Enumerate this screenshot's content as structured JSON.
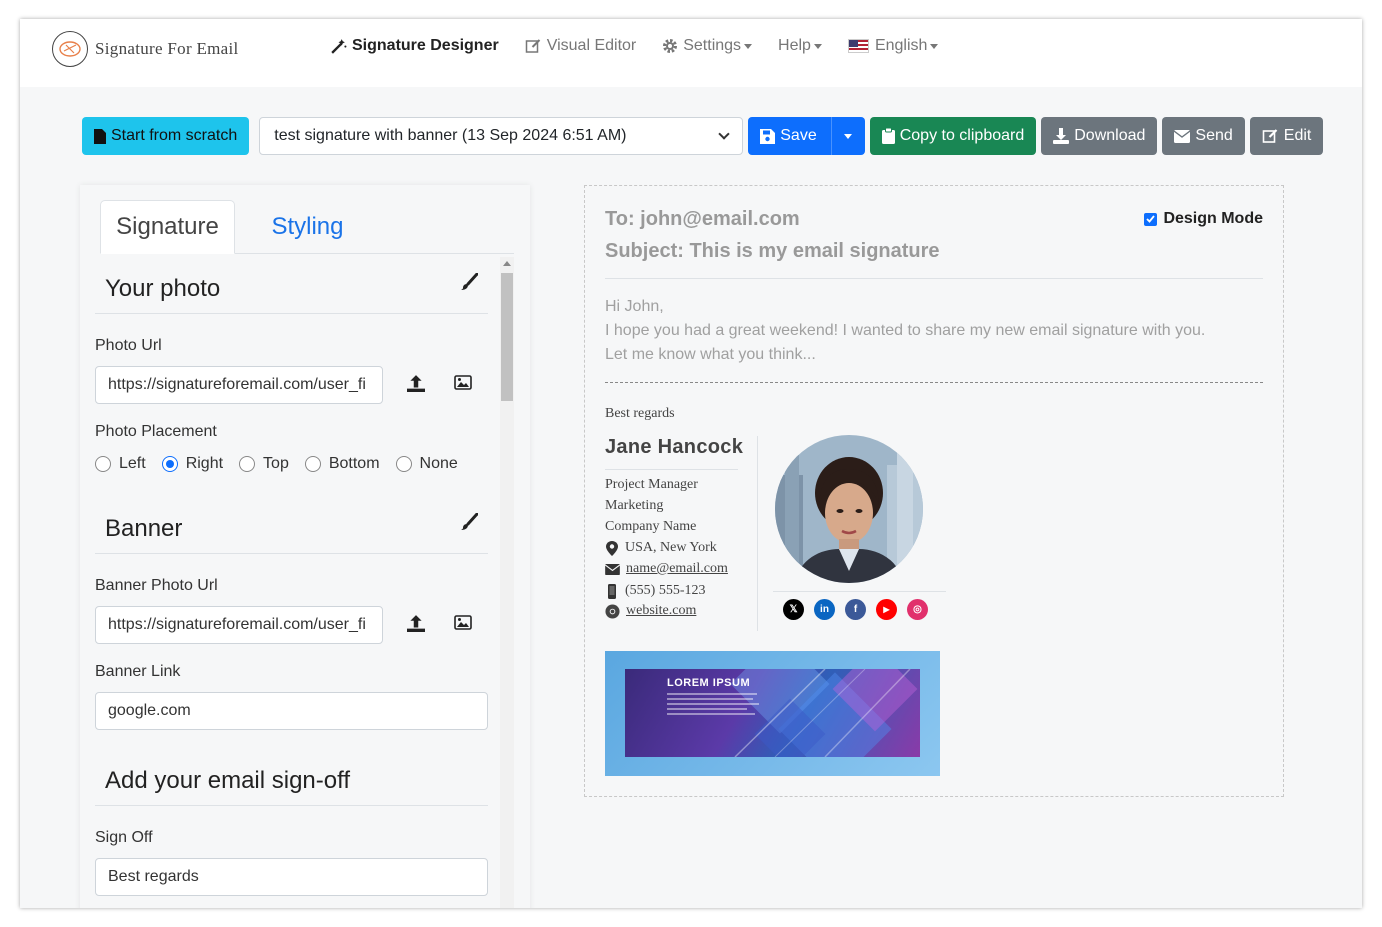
{
  "brand": {
    "name": "Signature For Email"
  },
  "nav": {
    "signature_designer": "Signature Designer",
    "visual_editor": "Visual Editor",
    "settings": "Settings",
    "help": "Help",
    "language": "English"
  },
  "toolbar": {
    "start_from_scratch": "Start from scratch",
    "selected_signature": "test signature with banner (13 Sep 2024 6:51 AM)",
    "save": "Save",
    "copy": "Copy to clipboard",
    "download": "Download",
    "send": "Send",
    "edit": "Edit"
  },
  "tabs": {
    "signature": "Signature",
    "styling": "Styling"
  },
  "photo_section": {
    "title": "Your photo",
    "photo_url_label": "Photo Url",
    "photo_url_value": "https://signatureforemail.com/user_fi",
    "placement_label": "Photo Placement",
    "placements": [
      "Left",
      "Right",
      "Top",
      "Bottom",
      "None"
    ],
    "selected_placement": "Right"
  },
  "banner_section": {
    "title": "Banner",
    "banner_url_label": "Banner Photo Url",
    "banner_url_value": "https://signatureforemail.com/user_fi",
    "banner_link_label": "Banner Link",
    "banner_link_value": "google.com"
  },
  "signoff_section": {
    "title": "Add your email sign-off",
    "label": "Sign Off",
    "value": "Best regards"
  },
  "preview": {
    "to": "To: john@email.com",
    "subject": "Subject: This is my email signature",
    "design_mode": "Design Mode",
    "design_mode_checked": true,
    "body_lines": [
      "Hi John,",
      "I hope you had a great weekend! I wanted to share my new email signature with you.",
      "Let me know what you think..."
    ]
  },
  "signature": {
    "sign_off": "Best regards",
    "name": "Jane Hancock",
    "title": "Project Manager",
    "department": "Marketing",
    "company": "Company Name",
    "location": "USA, New York",
    "email": "name@email.com",
    "phone": "(555) 555-123",
    "website": "website.com",
    "socials": [
      {
        "icon": "x-icon",
        "label": "𝕏",
        "color": "#000000"
      },
      {
        "icon": "linkedin-icon",
        "label": "in",
        "color": "#0a66c2"
      },
      {
        "icon": "facebook-icon",
        "label": "f",
        "color": "#3b5998"
      },
      {
        "icon": "youtube-icon",
        "label": "▶",
        "color": "#ff0000"
      },
      {
        "icon": "instagram-icon",
        "label": "◎",
        "color": "#e1306c"
      }
    ],
    "banner_title": "LOREM IPSUM"
  },
  "colors": {
    "primary": "#0d6efd",
    "info": "#1ec4ec",
    "success": "#198754",
    "secondary": "#6c757d",
    "link": "#1a73e8"
  }
}
